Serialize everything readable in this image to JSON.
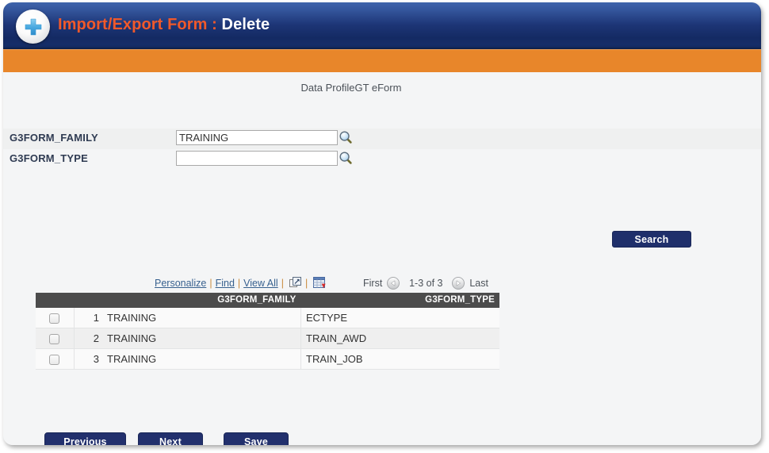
{
  "window": {
    "title_prefix": "Import/Export Form : ",
    "title_action": "Delete",
    "plus_icon": "plus-circle-icon"
  },
  "content": {
    "form_caption": "Data ProfileGT eForm"
  },
  "search_fields": [
    {
      "label": "G3FORM_FAMILY",
      "value": "TRAINING",
      "placeholder": "",
      "lookup_icon": "magnifier-icon"
    },
    {
      "label": "G3FORM_TYPE",
      "value": "",
      "placeholder": "",
      "lookup_icon": "magnifier-icon"
    }
  ],
  "search_button": {
    "label": "Search"
  },
  "grid": {
    "links": {
      "personalize": "Personalize",
      "find": "Find",
      "view_all": "View All",
      "separator": "|",
      "expand_icon": "expand-grid-icon",
      "download_icon": "download-to-spreadsheet-icon"
    },
    "nav": {
      "first": "First",
      "prev_icon": "previous-page-icon",
      "counter": "1-3 of 3",
      "next_icon": "next-page-icon",
      "last": "Last"
    },
    "columns": [
      "",
      "",
      "G3FORM_FAMILY",
      "G3FORM_TYPE"
    ],
    "rows": [
      {
        "checked": false,
        "num": "1",
        "family": "TRAINING",
        "type": "ECTYPE"
      },
      {
        "checked": false,
        "num": "2",
        "family": "TRAINING",
        "type": "TRAIN_AWD"
      },
      {
        "checked": false,
        "num": "3",
        "family": "TRAINING",
        "type": "TRAIN_JOB"
      }
    ]
  },
  "buttons": {
    "previous": "Previous",
    "next": "Next",
    "save": "Save"
  },
  "colors": {
    "title_bar_top": "#3f64ab",
    "title_bar_bottom": "#142a63",
    "orange_band": "#e8862a",
    "title_accent": "#f1592a",
    "button_navy": "#22306d",
    "grid_header": "#4c4c4c",
    "link_blue": "#38618f"
  }
}
